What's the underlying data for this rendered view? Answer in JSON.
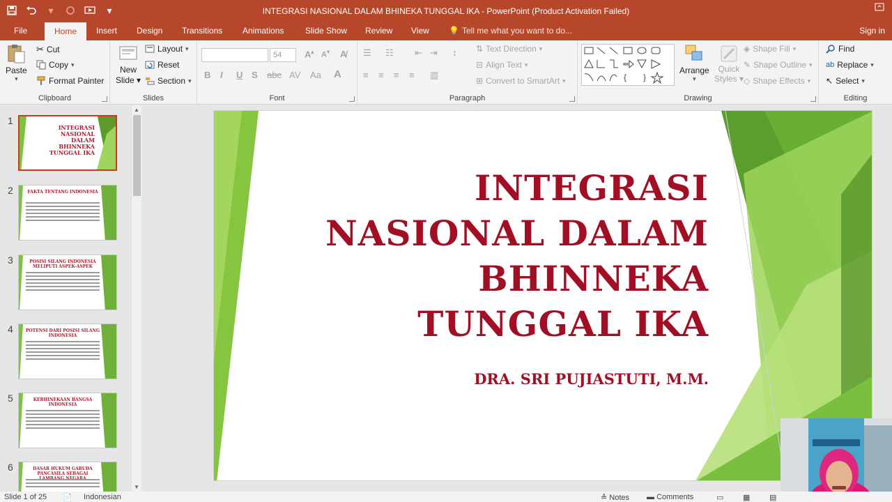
{
  "window": {
    "title": "INTEGRASI NASIONAL DALAM BHINEKA TUNGGAL IKA - PowerPoint (Product Activation Failed)"
  },
  "quick_access": {
    "save_icon": "save-icon",
    "undo_icon": "undo-icon",
    "redo_icon": "redo-icon",
    "present_icon": "start-from-beginning-icon"
  },
  "tabs": {
    "file": "File",
    "home": "Home",
    "insert": "Insert",
    "design": "Design",
    "transitions": "Transitions",
    "animations": "Animations",
    "slideshow": "Slide Show",
    "review": "Review",
    "view": "View",
    "tellme": "Tell me what you want to do...",
    "signin": "Sign in"
  },
  "ribbon": {
    "clipboard": {
      "label": "Clipboard",
      "paste": "Paste",
      "cut": "Cut",
      "copy": "Copy",
      "format_painter": "Format Painter"
    },
    "slides": {
      "label": "Slides",
      "new_slide_1": "New",
      "new_slide_2": "Slide",
      "layout": "Layout",
      "reset": "Reset",
      "section": "Section"
    },
    "font": {
      "label": "Font",
      "font_size": "54"
    },
    "paragraph": {
      "label": "Paragraph",
      "text_direction": "Text Direction",
      "align_text": "Align Text",
      "smartart": "Convert to SmartArt"
    },
    "drawing": {
      "label": "Drawing",
      "arrange": "Arrange",
      "quick_styles_1": "Quick",
      "quick_styles_2": "Styles",
      "shape_fill": "Shape Fill",
      "shape_outline": "Shape Outline",
      "shape_effects": "Shape Effects"
    },
    "editing": {
      "label": "Editing",
      "find": "Find",
      "replace": "Replace",
      "select": "Select"
    }
  },
  "thumbnails": [
    {
      "num": "1",
      "title": "INTEGRASI NASIONAL DALAM BHINNEKA TUNGGAL IKA"
    },
    {
      "num": "2",
      "title": "FAKTA TENTANG INDONESIA"
    },
    {
      "num": "3",
      "title": "POSISI SILANG INDONESIA MELIPUTI ASPEK-ASPEK"
    },
    {
      "num": "4",
      "title": "POTENSI DARI POSISI SILANG INDONESIA"
    },
    {
      "num": "5",
      "title": "KEBHINEKAAN BANGSA INDONESIA"
    },
    {
      "num": "6",
      "title": "DASAR HUKUM GARUDA PANCASILA SEBAGAI LAMBANG NEGARA"
    }
  ],
  "slide": {
    "title_lines": [
      "INTEGRASI",
      "NASIONAL DALAM",
      "BHINNEKA",
      "TUNGGAL IKA"
    ],
    "subtitle": "DRA. SRI PUJIASTUTI, M.M."
  },
  "status": {
    "slide_info": "Slide 1 of 25",
    "language": "Indonesian",
    "notes": "Notes",
    "comments": "Comments"
  },
  "colors": {
    "accent": "#b7472a",
    "title_red": "#a20f24",
    "green": "#7ec242"
  }
}
